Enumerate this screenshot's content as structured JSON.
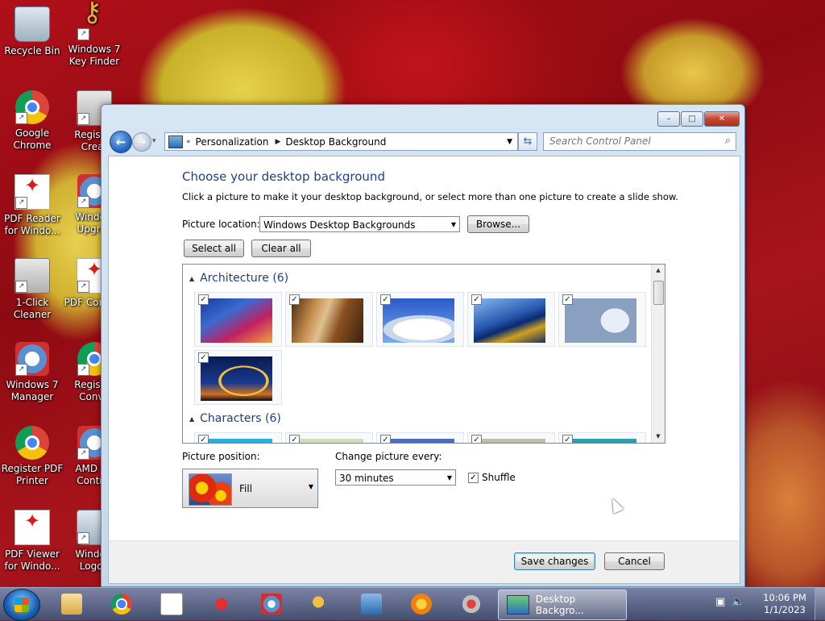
{
  "desktop": {
    "icons": [
      {
        "label": "Recycle Bin"
      },
      {
        "label": "Windows 7 Key Finder"
      },
      {
        "label": "Google Chrome"
      },
      {
        "label": "Register Creat"
      },
      {
        "label": "PDF Reader for Windo..."
      },
      {
        "label": "Window Upgrac"
      },
      {
        "label": "1-Click Cleaner"
      },
      {
        "label": "PDF Convert"
      },
      {
        "label": "Windows 7 Manager"
      },
      {
        "label": "Register Conve"
      },
      {
        "label": "Register PDF Printer"
      },
      {
        "label": "AMD Ca Control"
      },
      {
        "label": "PDF Viewer for Windo..."
      },
      {
        "label": "Window Logon"
      }
    ]
  },
  "window": {
    "controls": {
      "minimize": "–",
      "maximize": "□",
      "close": "✕"
    },
    "nav": {
      "back_glyph": "←",
      "forward_glyph": "→",
      "recent_glyph": "▾",
      "breadcrumb_lead": "«",
      "crumb_sep": "▶",
      "breadcrumb": [
        "Personalization",
        "Desktop Background"
      ],
      "address_dropdown": "▼",
      "refresh_glyph": "⇆",
      "search_placeholder": "Search Control Panel",
      "search_glyph": "⌕"
    },
    "heading": "Choose your desktop background",
    "subtext": "Click a picture to make it your desktop background, or select more than one picture to create a slide show.",
    "picture_location": {
      "label": "Picture location:",
      "value": "Windows Desktop Backgrounds",
      "browse": "Browse..."
    },
    "select_all": "Select all",
    "clear_all": "Clear all",
    "groups": [
      {
        "title": "Architecture (6)",
        "count": 6
      },
      {
        "title": "Characters (6)",
        "count": 6
      }
    ],
    "picture_position": {
      "label": "Picture position:",
      "value": "Fill"
    },
    "change_picture": {
      "label": "Change picture every:",
      "value": "30 minutes"
    },
    "shuffle": {
      "label": "Shuffle",
      "checked": true
    },
    "save": "Save changes",
    "cancel": "Cancel"
  },
  "taskbar": {
    "active_window": "Desktop Backgro...",
    "time": "10:06 PM",
    "date": "1/1/2023"
  },
  "glyphs": {
    "check": "✓",
    "collapse": "▲",
    "caret": "▼",
    "scroll_up": "▲",
    "scroll_down": "▼"
  }
}
